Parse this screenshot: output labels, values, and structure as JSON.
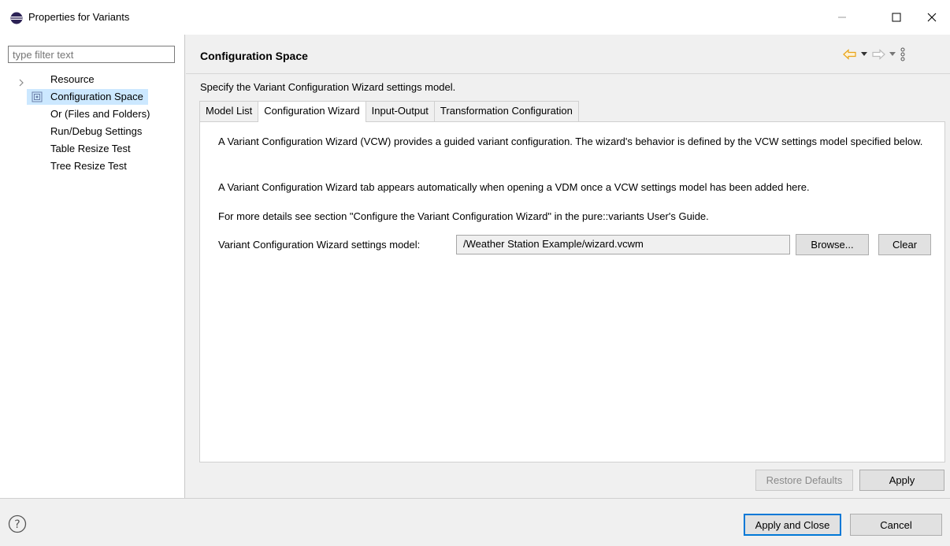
{
  "window": {
    "title": "Properties for Variants",
    "minimize_label": "—",
    "maximize_label": "☐",
    "close_label": "✕"
  },
  "sidebar": {
    "filter_placeholder": "type filter text",
    "items": [
      {
        "label": "Resource"
      },
      {
        "label": "Configuration Space"
      },
      {
        "label": "Or (Files and Folders)"
      },
      {
        "label": "Run/Debug Settings"
      },
      {
        "label": "Table Resize Test"
      },
      {
        "label": "Tree Resize Test"
      }
    ]
  },
  "page": {
    "title": "Configuration Space",
    "description": "Specify the Variant Configuration Wizard settings model."
  },
  "tabs": [
    {
      "label": "Model List"
    },
    {
      "label": "Configuration Wizard"
    },
    {
      "label": "Input-Output"
    },
    {
      "label": "Transformation Configuration"
    }
  ],
  "panel": {
    "intro": "A Variant Configuration Wizard (VCW) provides a guided variant configuration. The wizard's behavior is defined by the VCW settings model specified below.",
    "tab_note": "A Variant Configuration Wizard tab appears automatically when opening a VDM once a VCW settings model has been added here.",
    "details": "For more details see section \"Configure the Variant Configuration Wizard\" in the pure::variants User's Guide.",
    "settings_label": "Variant Configuration Wizard settings model:",
    "settings_value": "/Weather Station Example/wizard.vcwm",
    "browse_label": "Browse...",
    "clear_label": "Clear"
  },
  "page_buttons": {
    "restore_defaults": "Restore Defaults",
    "apply": "Apply"
  },
  "dialog_buttons": {
    "apply_and_close": "Apply and Close",
    "cancel": "Cancel"
  },
  "colors": {
    "selection": "#cce8ff",
    "nav_arrow": "#e8a317",
    "default_button_border": "#0078d7"
  }
}
